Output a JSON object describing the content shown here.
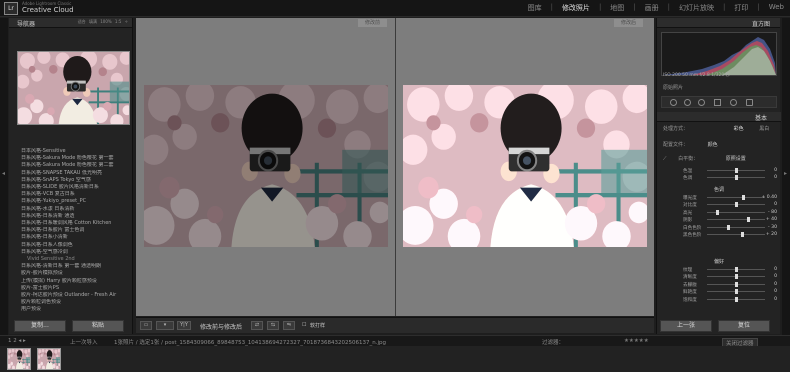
{
  "topbar": {
    "logo_text": "Lr",
    "brand_small": "Adobe Lightroom Classic",
    "brand_big": "Creative Cloud",
    "modules": [
      "图库",
      "修改照片",
      "地图",
      "画册",
      "幻灯片放映",
      "打印",
      "Web"
    ],
    "active_module": "修改照片"
  },
  "left_panel": {
    "navigator_title": "导航器",
    "zoom_options": "适合 填满 100% 1:5 ÷",
    "presets": [
      "日本风格-Sensitive",
      "日系风格-Sakura Mode 粉色樱花 第一套",
      "日系风格-Sakura Mode 粉色樱花 第二套",
      "日系风格-SNAPSE TAKAU 低光明亮",
      "日系风格-SnAPS Tokyo 空气感",
      "日系风格-SLIDE 胶片风格清新日系",
      "日系风格-VCB 复古日系",
      "日系风格-Yukiyo_preset_PC",
      "日系风格-水漾 日系清新",
      "日系风格-日系清新 通透",
      "日系风格-日系暖调风格 Cotton Kitchen",
      "日系风格-日系胶片 富士色调",
      "日系风格-日系小清新",
      "日系风格-日系人像调色",
      "日系风格-空气感冷调",
      "Vivid Sensitive 2nd",
      "日系风格-清新日系 第一套 通透明朗",
      "胶片-胶片模拟预设",
      "上传(模拟) Harry 胶片颗粒感预设",
      "胶片-富士胶片PS",
      "胶片-柯达胶片预设 Outlander - Fresh Air",
      "胶片颗粒调色预设",
      "用户预设"
    ],
    "sub_index": 15,
    "copy_button": "复制...",
    "paste_button": "粘贴"
  },
  "center": {
    "before_label": "修改前",
    "after_label": "修改后",
    "toolbar": {
      "view_icon": "▭",
      "yy_label": "Y|Y",
      "mode_text": "修改前与修改后",
      "softproof_text": "软打样"
    }
  },
  "right_panel": {
    "histogram_title": "直方图",
    "histogram_info": "ISO 200   50 mm   f/2.8   1/320 秒",
    "original_photo": "原始照片",
    "basic_title": "基本",
    "treatment_label": "处理方式：",
    "treatment_options": [
      "彩色",
      "黑白"
    ],
    "profile_label": "配置文件：",
    "profile_value": "颜色",
    "wb_label": "白平衡：",
    "wb_value": "原照设置",
    "tone_group": "色调",
    "presence_group": "偏好",
    "sliders_wb": [
      {
        "name": "色温",
        "value": "0",
        "pos": 0.5
      },
      {
        "name": "色调",
        "value": "0",
        "pos": 0.5
      }
    ],
    "sliders_tone": [
      {
        "name": "曝光度",
        "value": "+ 0.40",
        "pos": 0.62
      },
      {
        "name": "对比度",
        "value": "0",
        "pos": 0.5
      },
      {
        "name": "高光",
        "value": "- 80",
        "pos": 0.18
      },
      {
        "name": "阴影",
        "value": "+ 40",
        "pos": 0.7
      },
      {
        "name": "白色色阶",
        "value": "- 30",
        "pos": 0.36
      },
      {
        "name": "黑色色阶",
        "value": "+ 20",
        "pos": 0.6
      }
    ],
    "sliders_presence": [
      {
        "name": "纹理",
        "value": "0",
        "pos": 0.5
      },
      {
        "name": "清晰度",
        "value": "0",
        "pos": 0.5
      },
      {
        "name": "去朦胧",
        "value": "0",
        "pos": 0.5
      },
      {
        "name": "鲜艳度",
        "value": "0",
        "pos": 0.5
      },
      {
        "name": "饱和度",
        "value": "0",
        "pos": 0.5
      }
    ],
    "prev_button": "上一张",
    "reset_button": "复位"
  },
  "filmbar": {
    "nav": "1 2  ◂ ▸",
    "source": "上一次导入",
    "count": "1张照片 / 选定1张 / post_1584309066_89848753_104138694272327_7018736843202506137_n.jpg",
    "filter_label": "过滤器：",
    "filter_value": "关闭过滤器"
  },
  "colors": {
    "accent": "#d8d8d8",
    "panel": "#232323",
    "canvas": "#7d7d7d"
  }
}
